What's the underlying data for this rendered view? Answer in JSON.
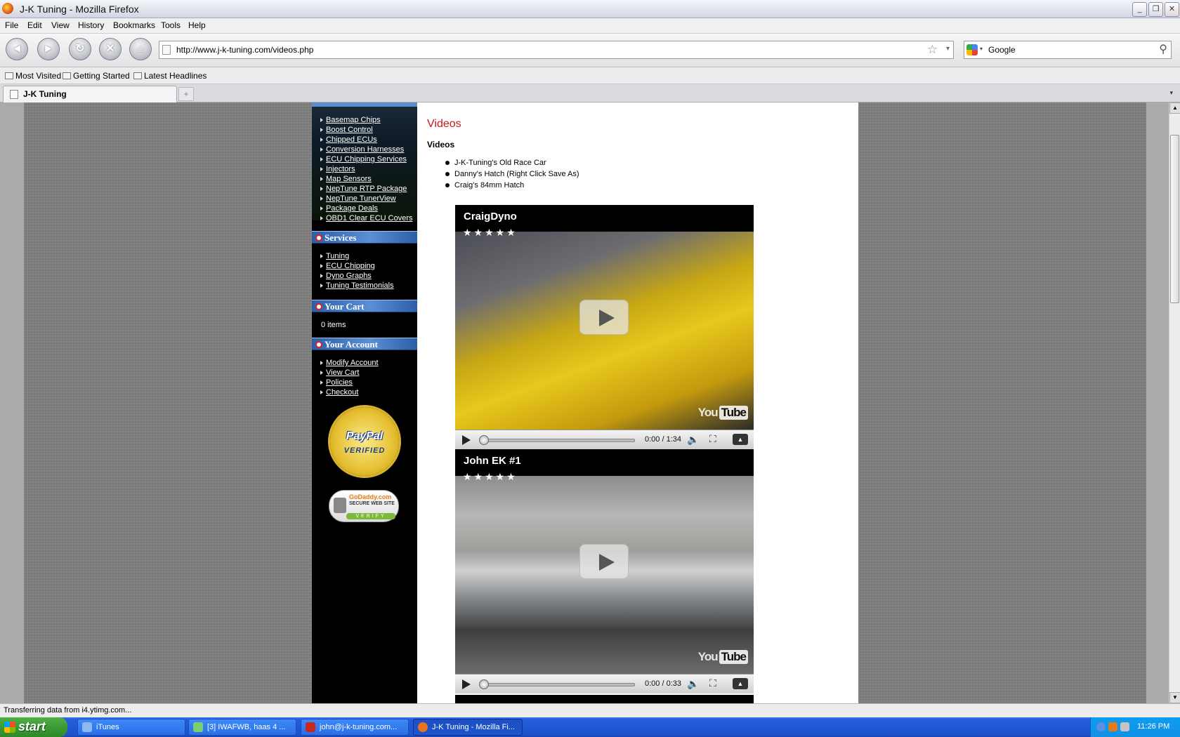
{
  "window": {
    "title": "J-K Tuning - Mozilla Firefox",
    "min_label": "_",
    "max_label": "❐",
    "close_label": "✕"
  },
  "menu": [
    "File",
    "Edit",
    "View",
    "History",
    "Bookmarks",
    "Tools",
    "Help"
  ],
  "nav": {
    "back": "◄",
    "forward": "►",
    "reload": "↻",
    "stop": "✕",
    "home": "⌂"
  },
  "urlbar": {
    "value": "http://www.j-k-tuning.com/videos.php",
    "star": "☆",
    "drop": "▾"
  },
  "searchbar": {
    "value": "Google",
    "drop": "▾",
    "icon": "⚲"
  },
  "bookmarks": [
    "Most Visited",
    "Getting Started",
    "Latest Headlines"
  ],
  "tabs": {
    "active": "J-K Tuning",
    "new_tab": "+",
    "menu": "▾"
  },
  "sidebar": {
    "products": [
      "Basemap Chips",
      "Boost Control",
      "Chipped ECUs",
      "Conversion Harnesses",
      "ECU Chipping Services",
      "Injectors",
      "Map Sensors",
      "NepTune RTP Package",
      "NepTune TunerView",
      "Package Deals",
      "OBD1 Clear ECU Covers"
    ],
    "services_heading": "Services",
    "services": [
      "Tuning",
      "ECU Chipping",
      "Dyno Graphs",
      "Tuning Testimonials"
    ],
    "cart_heading": "Your Cart",
    "cart_items": "0 items",
    "account_heading": "Your Account",
    "account": [
      "Modify Account",
      "View Cart",
      "Policies",
      "Checkout"
    ],
    "paypal": {
      "line1": "PayPal",
      "line2": "VERIFIED"
    },
    "godaddy": {
      "line1": "GoDaddy.com",
      "line2": "SECURE WEB SITE",
      "line3": "VERIFY"
    }
  },
  "content": {
    "page_title": "Videos",
    "section_title": "Videos",
    "video_list": [
      "J-K-Tuning's Old Race Car",
      "Danny's Hatch (Right Click Save As)",
      "Craig's 84mm Hatch"
    ]
  },
  "players": [
    {
      "title": "CraigDyno",
      "stars": "★★★★★",
      "time": "0:00 / 1:34",
      "logo_you": "You",
      "logo_tube": "Tube"
    },
    {
      "title": "John EK #1",
      "stars": "★★★★★",
      "time": "0:00 / 0:33",
      "logo_you": "You",
      "logo_tube": "Tube"
    }
  ],
  "player_icons": {
    "volume": "🔈",
    "fullscreen": "⛶",
    "eject": "▲"
  },
  "scroll": {
    "up": "▲",
    "down": "▼"
  },
  "status": "Transferring data from i4.ytimg.com...",
  "taskbar": {
    "start": "start",
    "tasks": [
      "iTunes",
      "[3] IWAFWB, haas 4 ...",
      "john@j-k-tuning.com...",
      "J-K Tuning - Mozilla Fi..."
    ],
    "clock": "11:26 PM"
  }
}
